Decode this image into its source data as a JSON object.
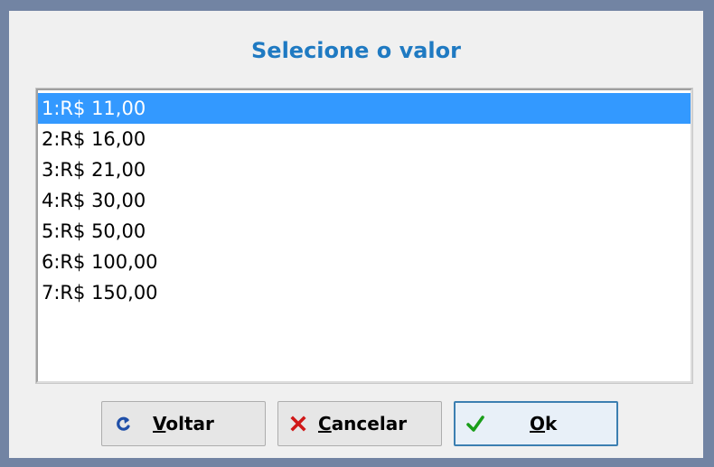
{
  "dialog": {
    "title": "Selecione o valor"
  },
  "list": {
    "selected_index": 0,
    "items": [
      {
        "label": "1:R$ 11,00"
      },
      {
        "label": "2:R$ 16,00"
      },
      {
        "label": "3:R$ 21,00"
      },
      {
        "label": "4:R$ 30,00"
      },
      {
        "label": "5:R$ 50,00"
      },
      {
        "label": "6:R$ 100,00"
      },
      {
        "label": "7:R$ 150,00"
      }
    ]
  },
  "buttons": {
    "back": {
      "label_mnemonic": "V",
      "label_rest": "oltar",
      "icon": "back-arrow-icon",
      "icon_color": "#1f4fa8"
    },
    "cancel": {
      "label_mnemonic": "C",
      "label_rest": "ancelar",
      "icon": "close-icon",
      "icon_color": "#d01818"
    },
    "ok": {
      "label_mnemonic": "O",
      "label_rest": "k",
      "icon": "check-icon",
      "icon_color": "#1a9e1a"
    }
  },
  "colors": {
    "title": "#1f7ac2",
    "selection": "#3399ff",
    "frame": "#7284a3"
  }
}
